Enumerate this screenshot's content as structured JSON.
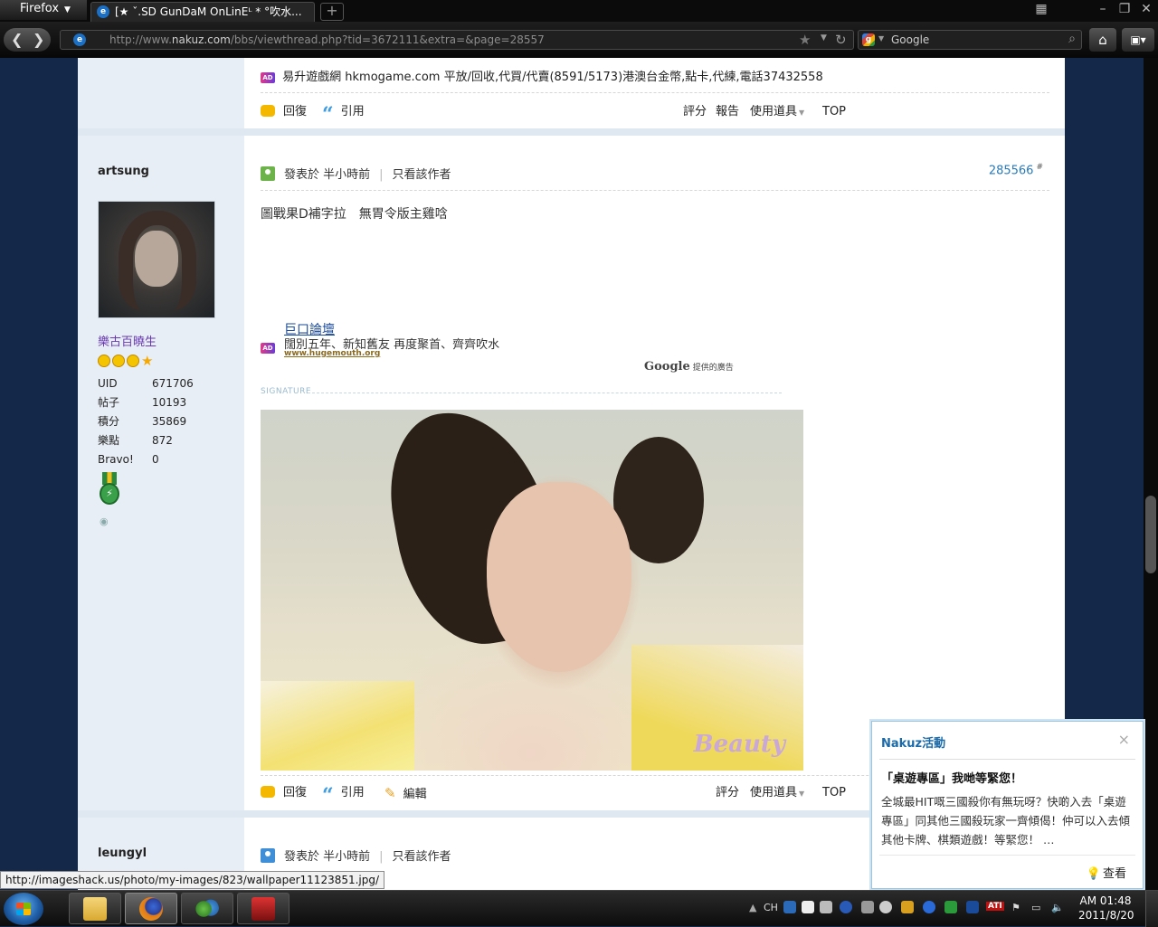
{
  "browser": {
    "menu_label": "Firefox",
    "tab_title": "[★ ˇ.SD GunDaM OnLinEᴸ * °吹水...",
    "url_prefix": "http://www.",
    "url_domain": "nakuz.com",
    "url_rest": "/bbs/viewthread.php?tid=3672111&extra=&page=28557",
    "search_placeholder": "Google"
  },
  "posts": [
    {
      "ad": {
        "badge": "AD",
        "text": "易升遊戲網 hkmogame.com 平放/回收,代買/代賣(8591/5173)港澳台金幣,點卡,代練,電話37432558"
      },
      "actions": {
        "reply": "回復",
        "quote": "引用",
        "rate": "評分",
        "report": "報告",
        "tools": "使用道具",
        "top": "TOP"
      }
    },
    {
      "username": "artsung",
      "rank": "樂古百曉生",
      "stats": [
        {
          "k": "UID",
          "v": "671706"
        },
        {
          "k": "帖子",
          "v": "10193"
        },
        {
          "k": "積分",
          "v": "35869"
        },
        {
          "k": "樂點",
          "v": "872"
        },
        {
          "k": "Bravo!",
          "v": "0"
        }
      ],
      "posted": "發表於 半小時前",
      "only_author": "只看該作者",
      "floor": "285566",
      "floor_mark": "#",
      "content": "圖戰果D補字拉　無胃令版主雞唅",
      "google_ad": {
        "badge": "AD",
        "title": "巨口論壇",
        "desc": "闊別五年、新知舊友 再度聚首、齊齊吹水",
        "url": "www.hugemouth.org",
        "provider": "Google",
        "provider_suffix": "提供的廣告"
      },
      "signature_label": "SIGNATURE",
      "signature_image_text": "Beauty",
      "actions": {
        "reply": "回復",
        "quote": "引用",
        "edit": "編輯",
        "rate": "評分",
        "tools": "使用道具",
        "top": "TOP"
      }
    },
    {
      "username": "leungyl",
      "posted": "發表於 半小時前",
      "only_author": "只看該作者"
    }
  ],
  "notification": {
    "title": "Nakuz活動",
    "close": "×",
    "headline": "「桌遊專區」我哋等緊您！",
    "body": "全城最HIT嘅三國殺你有無玩呀？快啲入去「桌遊專區」同其他三國殺玩家一齊傾偈！仲可以入去傾其他卡牌、棋類遊戲！等緊您！ …",
    "view": "查看"
  },
  "status_url": "http://imageshack.us/photo/my-images/823/wallpaper11123851.jpg/",
  "taskbar": {
    "lang": "CH",
    "time": "AM 01:48",
    "date": "2011/8/20",
    "ati": "ATI"
  }
}
